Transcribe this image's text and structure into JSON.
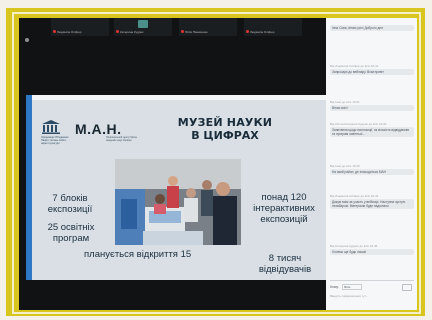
{
  "meeting": {
    "participants": [
      {
        "name": "Людмила Оліфер"
      },
      {
        "name": "Катерина Кудрик"
      },
      {
        "name": "Юлія Панасенко"
      },
      {
        "name": "Людмила Оліфер"
      }
    ]
  },
  "slide": {
    "logo_unesco_caption": "Організація Об'єднаних Націй з питань освіти, науки і культури",
    "logo_man": "М.А.Н.",
    "logo_man_caption": "Національний центр Мала академія наук України",
    "title_line1": "МУЗЕЙ НАУКИ",
    "title_line2": "В ЦИФРАХ",
    "stat1_line1": "7 блоків",
    "stat1_line2": "експозиції",
    "stat2_line1": "25 освітніх",
    "stat2_line2": "програм",
    "stat3_line1": "понад 120",
    "stat3_line2": "інтерактивних",
    "stat3_line3": "експозицій",
    "stat4_line1": "8 тисяч",
    "stat4_line2": "відвідувачів",
    "opening_text": "планується відкриття",
    "opening_num": "15"
  },
  "chat": {
    "messages": [
      {
        "meta": "",
        "text": "Інна Сова, вітаю усіх! Доброго дня"
      },
      {
        "meta": "Від Людмила Оліфер до всіх 10:41",
        "text": "Запрошую до вебінару. Всім привіт"
      },
      {
        "meta": "Від Інна до всіх 10:41",
        "text": "Вітаю всіх!"
      },
      {
        "meta": "Від Ольга Катерина Кудрик до всіх 10:42",
        "text": "Запитання щодо експозиції, як кількість відвідувачів та програм освітньої..."
      },
      {
        "meta": "Від Інна до всіх 10:43",
        "text": "На який район, де знаходиться МАН"
      },
      {
        "meta": "Від Людмила Оліфер до всіх 10:44",
        "text": "Дякую всім за участь у вебінарі. Наступна зустріч незабаром. Матеріали буде надіслано"
      },
      {
        "meta": "Від Катерина Кудрик до всіх 10:45",
        "text": "Хочемо ще будь ласка!"
      }
    ],
    "to_label": "Кому:",
    "to_value": "Всім",
    "placeholder": "Введіть повідомлення тут..."
  },
  "colors": {
    "frame_yellow": "#d8c51e",
    "slide_blue_band": "#2f78c7"
  }
}
